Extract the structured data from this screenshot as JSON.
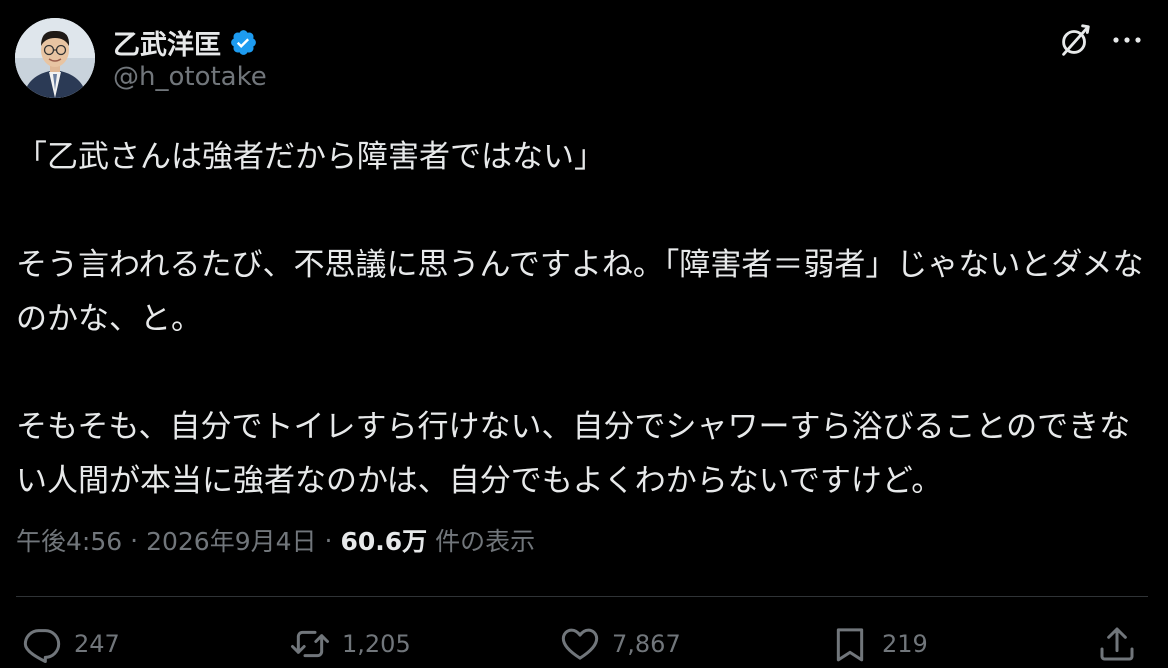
{
  "author": {
    "display_name": "乙武洋匡",
    "handle": "@h_ototake",
    "verified": true
  },
  "tweet": {
    "paragraphs": [
      "「乙武さんは強者だから障害者ではない」",
      "そう言われるたび、不思議に思うんですよね。「障害者＝弱者」じゃないとダメなのかな、と。",
      "そもそも、自分でトイレすら行けない、自分でシャワーすら浴びることのできない人間が本当に強者なのかは、自分でもよくわからないですけど。"
    ]
  },
  "meta": {
    "time": "午後4:56",
    "separator": "·",
    "date": "2026年9月4日",
    "views_count": "60.6万",
    "views_label": "件の表示"
  },
  "actions": {
    "replies": "247",
    "retweets": "1,205",
    "likes": "7,867",
    "bookmarks": "219"
  },
  "colors": {
    "background": "#000000",
    "text": "#e7e9ea",
    "muted": "#71767b",
    "verified": "#1d9bf0",
    "divider": "#2f3336"
  },
  "icons": [
    "verified-badge-icon",
    "grok-icon",
    "more-icon",
    "reply-icon",
    "retweet-icon",
    "like-icon",
    "bookmark-icon",
    "share-icon"
  ]
}
